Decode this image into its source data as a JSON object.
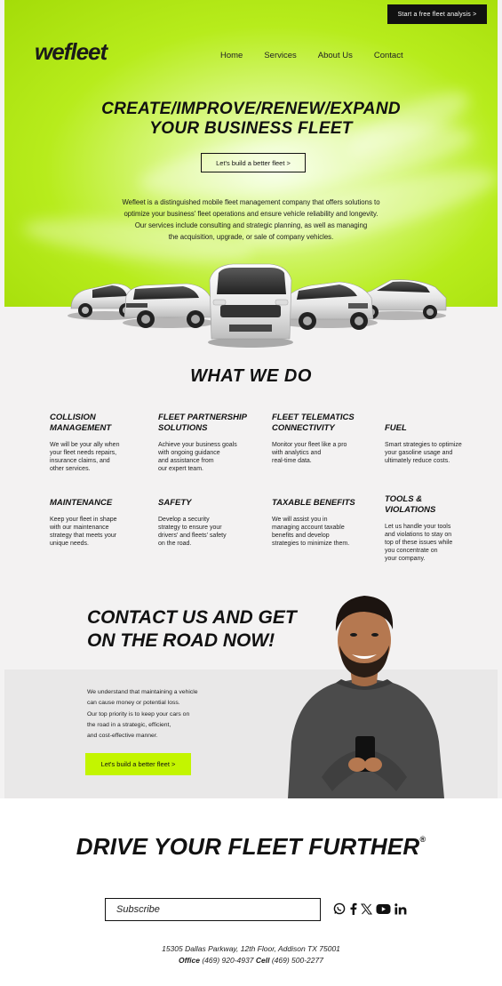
{
  "header": {
    "cta_label": "Start a free fleet analysis  >",
    "logo": "wefleet",
    "nav": [
      "Home",
      "Services",
      "About Us",
      "Contact"
    ]
  },
  "hero": {
    "title_line1": "CREATE/IMPROVE/RENEW/EXPAND",
    "title_line2": "YOUR BUSINESS FLEET",
    "button_label": "Let's build a better fleet  >",
    "description_lines": [
      "Wefleet is a distinguished mobile fleet management company that offers solutions to",
      "optimize your business' fleet operations and ensure vehicle reliability and longevity.",
      "Our services include consulting and strategic planning, as well as managing",
      "the acquisition, upgrade, or sale of company vehicles."
    ]
  },
  "what_we_do": {
    "title": "WHAT WE DO",
    "services": [
      {
        "title_line1": "COLLISION",
        "title_line2": "MANAGEMENT",
        "lines": [
          "We will be your ally when",
          "your fleet needs repairs,",
          "insurance claims, and",
          "other services."
        ]
      },
      {
        "title_line1": "FLEET PARTNERSHIP",
        "title_line2": "SOLUTIONS",
        "lines": [
          "Achieve your business goals",
          "with ongoing guidance",
          "and assistance from",
          "our expert team."
        ]
      },
      {
        "title_line1": "FLEET TELEMATICS",
        "title_line2": "CONNECTIVITY",
        "lines": [
          "Monitor your fleet like a pro",
          "with analytics and",
          "real-time data."
        ]
      },
      {
        "title_line1": "",
        "title_line2": "FUEL",
        "lines": [
          "Smart strategies to optimize",
          "your gasoline usage and",
          "ultimately reduce costs."
        ]
      },
      {
        "title_line1": "",
        "title_line2": "MAINTENANCE",
        "lines": [
          "Keep your fleet in shape",
          "with our maintenance",
          "strategy that meets your",
          "unique needs."
        ]
      },
      {
        "title_line1": "",
        "title_line2": "SAFETY",
        "lines": [
          "Develop a security",
          "strategy to ensure your",
          "drivers' and fleets' safety",
          "on the road."
        ]
      },
      {
        "title_line1": "",
        "title_line2": "TAXABLE BENEFITS",
        "lines": [
          "We will assist you in",
          "managing account taxable",
          "benefits and develop",
          "strategies to minimize them."
        ]
      },
      {
        "title_line1": "TOOLS &",
        "title_line2": "VIOLATIONS",
        "lines": [
          "Let us handle your tools",
          "and violations to stay on",
          "top of these issues while",
          "you concentrate on",
          "your company."
        ]
      }
    ]
  },
  "contact": {
    "title_line1": "CONTACT US AND GET",
    "title_line2": "ON THE ROAD NOW!",
    "lines": [
      "We understand that maintaining a vehicle",
      "can cause money or potential loss.",
      "Our top priority is to keep your cars on",
      "the road in a strategic, efficient,",
      "and cost-effective manner."
    ],
    "button_label": "Let's build a better fleet  >"
  },
  "footer": {
    "tagline": "DRIVE YOUR FLEET FURTHER",
    "registered": "®",
    "subscribe_placeholder": "Subscribe",
    "social_icons": [
      "whatsapp-icon",
      "facebook-icon",
      "x-icon",
      "youtube-icon",
      "linkedin-icon"
    ],
    "address": "15305 Dallas Parkway, 12th Floor, Addison TX 75001",
    "office_label": "Office",
    "office_phone": "(469) 920-4937",
    "cell_label": "Cell",
    "cell_phone": "(469) 500-2277"
  },
  "colors": {
    "accent": "#C3F500",
    "dark": "#111111",
    "band": "#E9E8E8"
  }
}
